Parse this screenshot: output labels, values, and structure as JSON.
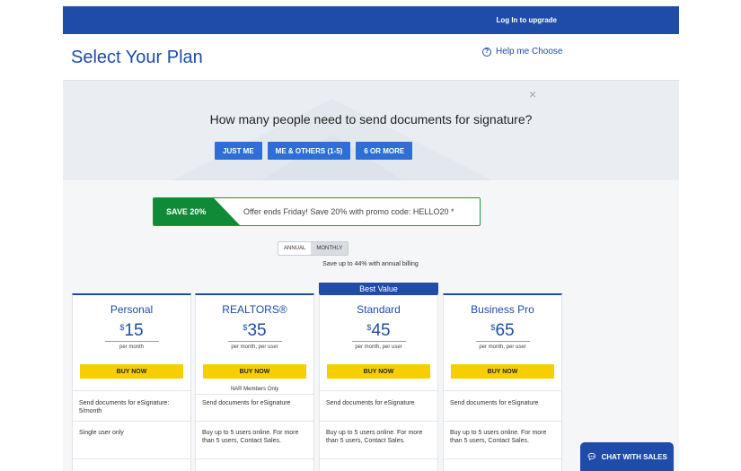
{
  "header": {
    "login_label": "Log In to upgrade"
  },
  "title": "Select Your Plan",
  "help": {
    "icon": "question-circle-icon",
    "label": "Help me Choose"
  },
  "question_panel": {
    "close_glyph": "×",
    "question": "How many people need to send documents for signature?",
    "options": [
      "JUST ME",
      "ME & OTHERS (1-5)",
      "6 OR MORE"
    ]
  },
  "promo": {
    "badge": "SAVE 20%",
    "text": "Offer ends Friday! Save 20% with promo code: HELLO20 *"
  },
  "billing": {
    "options": [
      "ANNUAL",
      "MONTHLY"
    ],
    "selected": "MONTHLY",
    "note": "Save up to 44% with annual billing"
  },
  "best_value_label": "Best Value",
  "plans": [
    {
      "name": "Personal",
      "currency": "$",
      "price": "15",
      "period": "per month",
      "buy_label": "BUY NOW",
      "note": "",
      "features": [
        "Send documents for eSignature: 5/month",
        "Single user only"
      ]
    },
    {
      "name": "REALTORS®",
      "currency": "$",
      "price": "35",
      "period": "per month, per user",
      "buy_label": "BUY NOW",
      "note": "NAR Members Only",
      "features": [
        "Send documents for eSignature",
        "Buy up to 5 users online. For more than 5 users, Contact Sales."
      ]
    },
    {
      "name": "Standard",
      "currency": "$",
      "price": "45",
      "period": "per month, per user",
      "buy_label": "BUY NOW",
      "note": "",
      "features": [
        "Send documents for eSignature",
        "Buy up to 5 users online. For more than 5 users, Contact Sales."
      ]
    },
    {
      "name": "Business Pro",
      "currency": "$",
      "price": "65",
      "period": "per month, per user",
      "buy_label": "BUY NOW",
      "note": "",
      "features": [
        "Send documents for eSignature",
        "Buy up to 5 users online. For more than 5 users, Contact Sales."
      ]
    }
  ],
  "chat": {
    "icon": "chat-bubble-icon",
    "label": "CHAT WITH SALES"
  },
  "colors": {
    "brand_blue": "#1e4ca8",
    "button_blue": "#2d6fd6",
    "buy_yellow": "#f7cf00",
    "promo_green": "#108a36"
  }
}
